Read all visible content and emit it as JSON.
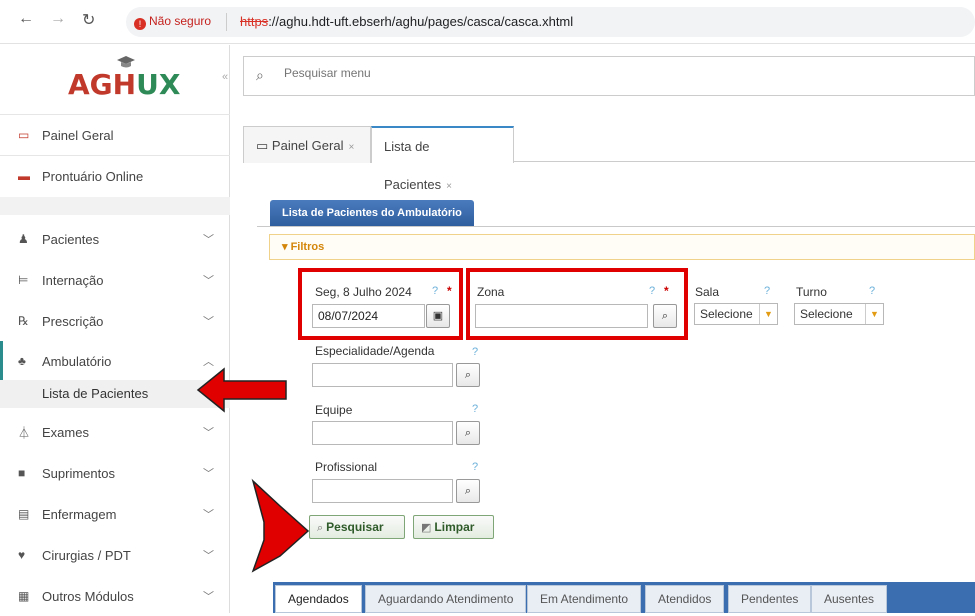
{
  "browser": {
    "security_label": "Não seguro",
    "url_proto": "https",
    "url_rest": "://aghu.hdt-uft.ebserh/aghu/pages/casca/casca.xhtml"
  },
  "app": {
    "logo_text": "AGH",
    "logo_accent": "UX"
  },
  "sidebar": {
    "items": [
      {
        "label": "Painel Geral",
        "icon": "monitor-icon"
      },
      {
        "label": "Prontuário Online",
        "icon": "folder-icon"
      },
      {
        "label": "Pacientes",
        "icon": "user-icon"
      },
      {
        "label": "Internação",
        "icon": "bed-icon"
      },
      {
        "label": "Prescrição",
        "icon": "prescription-icon"
      },
      {
        "label": "Ambulatório",
        "icon": "outpatient-icon"
      },
      {
        "label": "Exames",
        "icon": "flask-icon"
      },
      {
        "label": "Suprimentos",
        "icon": "box-icon"
      },
      {
        "label": "Enfermagem",
        "icon": "card-icon"
      },
      {
        "label": "Cirurgias / PDT",
        "icon": "heart-icon"
      },
      {
        "label": "Outros Módulos",
        "icon": "grid-icon"
      }
    ],
    "sub_item": "Lista de Pacientes"
  },
  "search": {
    "placeholder": "Pesquisar menu"
  },
  "tabs": [
    {
      "label": "Painel Geral"
    },
    {
      "label": "Lista de Pacientes"
    }
  ],
  "panel": {
    "title": "Lista de Pacientes do Ambulatório",
    "filters_label": "Filtros"
  },
  "form": {
    "date_label": "Seg, 8 Julho 2024",
    "date_value": "08/07/2024",
    "zona_label": "Zona",
    "zona_value": "",
    "sala_label": "Sala",
    "sala_value": "Selecione",
    "turno_label": "Turno",
    "turno_value": "Selecione",
    "especialidade_label": "Especialidade/Agenda",
    "equipe_label": "Equipe",
    "profissional_label": "Profissional",
    "help": "?",
    "required": "*"
  },
  "buttons": {
    "pesquisar": "Pesquisar",
    "limpar": "Limpar"
  },
  "bottom_tabs": [
    {
      "label": "Agendados"
    },
    {
      "label": "Aguardando Atendimento"
    },
    {
      "label": "Em Atendimento"
    },
    {
      "label": "Atendidos"
    },
    {
      "label": "Pendentes"
    },
    {
      "label": "Ausentes"
    }
  ],
  "colors": {
    "annotation_red": "#e00000",
    "panel_blue": "#2f5e9e",
    "logo_red": "#c0392b"
  }
}
